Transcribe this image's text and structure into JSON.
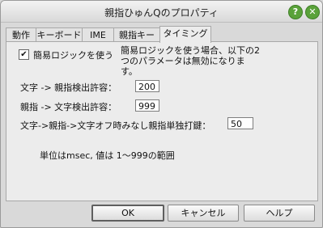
{
  "window": {
    "title": "親指ひゅんQのプロパティ"
  },
  "titlebar": {
    "help_label": "?",
    "close_label": "✕"
  },
  "tabs": [
    {
      "label": "動作"
    },
    {
      "label": "キーボード"
    },
    {
      "label": "IME"
    },
    {
      "label": "親指キー"
    },
    {
      "label": "タイミング",
      "active": true
    }
  ],
  "timing": {
    "simple_logic": {
      "checked": true,
      "checkmark": "✔",
      "label": "簡易ロジックを使う",
      "note_line1": "簡易ロジックを使う場合、以下の2",
      "note_line2": "つのパラメータは無効になりま",
      "note_line3": "す。"
    },
    "char_to_thumb": {
      "label": "文字 -> 親指検出許容：",
      "value": "200"
    },
    "thumb_to_char": {
      "label": "親指 -> 文字検出許容：",
      "value": "999"
    },
    "char_thumb_off": {
      "label": "文字->親指->文字オフ時みなし親指単独打鍵：",
      "value": "50"
    },
    "unit_note": "単位はmsec, 値は 1～999の範囲"
  },
  "buttons": {
    "ok": "OK",
    "cancel": "キャンセル",
    "help": "ヘルプ"
  }
}
